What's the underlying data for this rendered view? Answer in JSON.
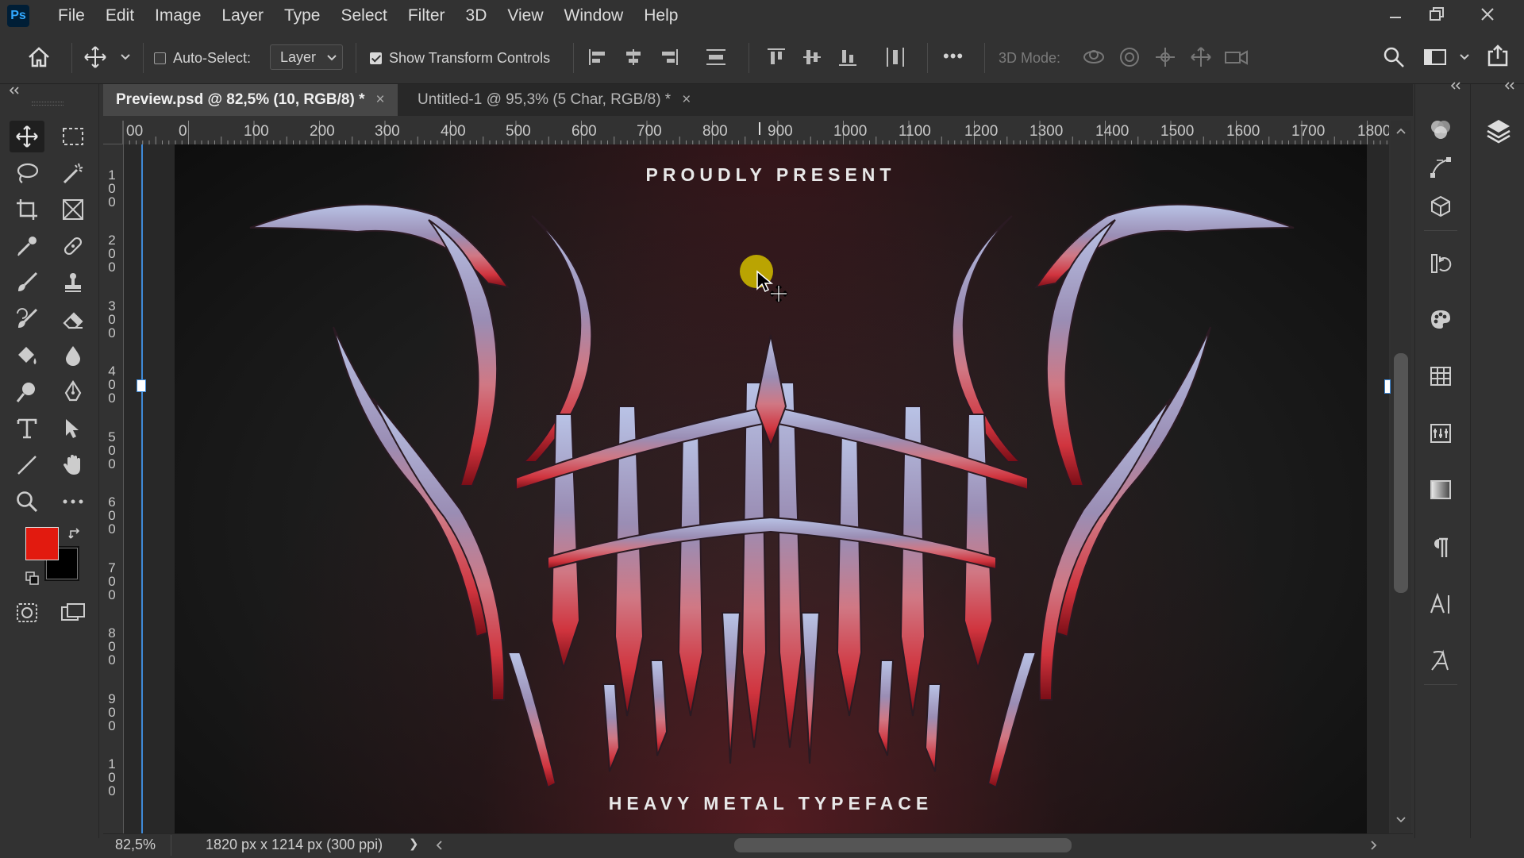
{
  "app": {
    "logo": "Ps"
  },
  "menu": [
    "File",
    "Edit",
    "Image",
    "Layer",
    "Type",
    "Select",
    "Filter",
    "3D",
    "View",
    "Window",
    "Help"
  ],
  "options": {
    "auto_select_label": "Auto-Select:",
    "auto_select_checked": false,
    "layer_select_value": "Layer",
    "show_transform_label": "Show Transform Controls",
    "show_transform_checked": true,
    "more_label": "•••",
    "mode_3d_label": "3D Mode:"
  },
  "tabs": [
    {
      "label": "Preview.psd @ 82,5% (10, RGB/8) *",
      "close": "×",
      "active": true
    },
    {
      "label": "Untitled-1 @ 95,3% (5 Char, RGB/8) *",
      "close": "×",
      "active": false
    }
  ],
  "ruler": {
    "horizontal": [
      "00",
      "0",
      "100",
      "200",
      "300",
      "400",
      "500",
      "600",
      "700",
      "800",
      "900",
      "1000",
      "1100",
      "1200",
      "1300",
      "1400",
      "1500",
      "1600",
      "1700",
      "1800"
    ],
    "vertical": [
      [
        "1",
        "0",
        "0"
      ],
      [
        "2",
        "0",
        "0"
      ],
      [
        "3",
        "0",
        "0"
      ],
      [
        "4",
        "0",
        "0"
      ],
      [
        "5",
        "0",
        "0"
      ],
      [
        "6",
        "0",
        "0"
      ],
      [
        "7",
        "0",
        "0"
      ],
      [
        "8",
        "0",
        "0"
      ],
      [
        "9",
        "0",
        "0"
      ],
      [
        "1",
        "0",
        "0"
      ]
    ]
  },
  "artwork": {
    "top_text": "PROUDLY PRESENT",
    "bottom_text": "HEAVY METAL TYPEFACE"
  },
  "colors": {
    "foreground": "#e21a0f",
    "background": "#000000"
  },
  "status": {
    "zoom": "82,5%",
    "doc_info": "1820 px x 1214 px (300 ppi)",
    "arrow": "❯"
  }
}
